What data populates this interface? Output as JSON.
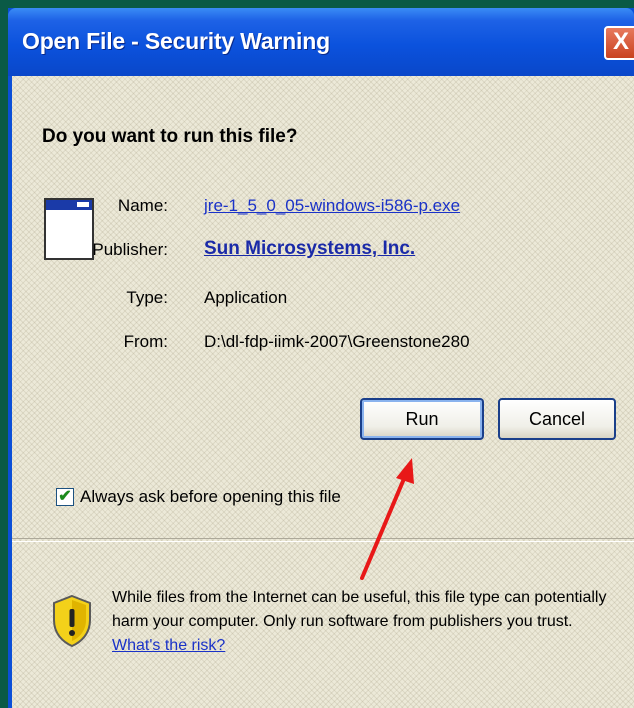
{
  "window": {
    "title": "Open File - Security Warning",
    "close_label": "X"
  },
  "dialog": {
    "question": "Do you want to run this file?",
    "fields": {
      "name_label": "Name:",
      "name_value": "jre-1_5_0_05-windows-i586-p.exe",
      "publisher_label": "Publisher:",
      "publisher_value": "Sun Microsystems, Inc.",
      "type_label": "Type:",
      "type_value": "Application",
      "from_label": "From:",
      "from_value": "D:\\dl-fdp-iimk-2007\\Greenstone280"
    },
    "buttons": {
      "run": "Run",
      "cancel": "Cancel"
    },
    "checkbox": {
      "label": "Always ask before opening this file",
      "checked": true
    },
    "warning": {
      "text": "While files from the Internet can be useful, this file type can potentially harm your computer. Only run software from publishers you trust.",
      "link": "What's the risk?"
    }
  },
  "colors": {
    "titlebar": "#0b52dd",
    "client_bg": "#ece9d8",
    "link": "#1a32c8",
    "arrow": "#e81818"
  }
}
